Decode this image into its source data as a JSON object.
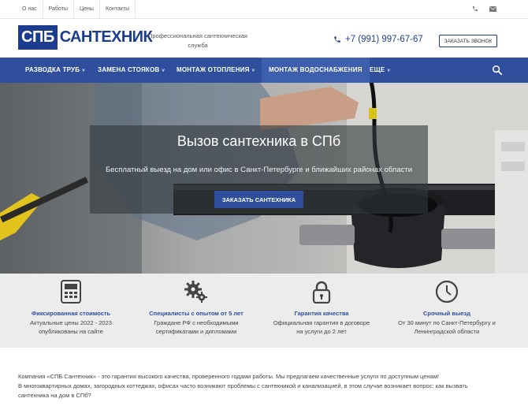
{
  "topbar": {
    "links": [
      "О нас",
      "Работы",
      "Цены",
      "Контакты"
    ]
  },
  "header": {
    "logo_box": "СПБ",
    "logo_rest": "САНТЕХНИК",
    "tagline": "Профессиональная сантехническая служба",
    "phone": "+7 (991) 997-67-67",
    "call_button": "ЗАКАЗАТЬ ЗВОНОК"
  },
  "nav": {
    "items": [
      {
        "label": "РАЗВОДКА ТРУБ",
        "chevron": "˅"
      },
      {
        "label": "ЗАМЕНА СТОЯКОВ",
        "chevron": "˅"
      },
      {
        "label": "МОНТАЖ ОТОПЛЕНИЯ",
        "chevron": "˅"
      },
      {
        "label": "МОНТАЖ ВОДОСНАБЖЕНИЯ",
        "chevron": ""
      },
      {
        "label": "ЕЩЕ",
        "chevron": "˅"
      }
    ]
  },
  "hero": {
    "title": "Вызов сантехника в СПб",
    "subtitle": "Бесплатный выезд на дом или офис в Санкт-Петербурге и ближайших районах области",
    "button": "ЗАКАЗАТЬ САНТЕХНИКА"
  },
  "features": [
    {
      "icon": "calculator-icon",
      "title": "Фиксированная стоимость",
      "desc1": "Актуальные цены 2022 - 2023",
      "desc2": "опубликованы на сайте"
    },
    {
      "icon": "gears-icon",
      "title": "Специалисты с опытом от 5 лет",
      "desc1": "Граждане РФ с необходимыми",
      "desc2": "сертификатами и дипломами"
    },
    {
      "icon": "lock-icon",
      "title": "Гарантия качества",
      "desc1": "Официальная гарантия в договоре",
      "desc2": "на услуги до 2 лет"
    },
    {
      "icon": "clock-icon",
      "title": "Срочный выезд",
      "desc1": "От 30 минут по Санкт-Петербургу и",
      "desc2": "Ленинградской области"
    }
  ],
  "body_text": {
    "line1": "Компания «СПБ Сантехник» - это гарантия высокого качества, проверенного годами работы. Мы предлагаем качественные услуги по доступным ценам!",
    "line2": "В многоквартирных домах, загородных коттеджах, офисах часто возникают проблемы с сантехникой и канализацией, в этом случае возникает вопрос: как вызвать",
    "line3": "сантехника на дом в СПб?"
  },
  "colors": {
    "brand": "#1c3d8f",
    "nav_bg": "#2f4f9d",
    "features_bg": "#ececec"
  }
}
